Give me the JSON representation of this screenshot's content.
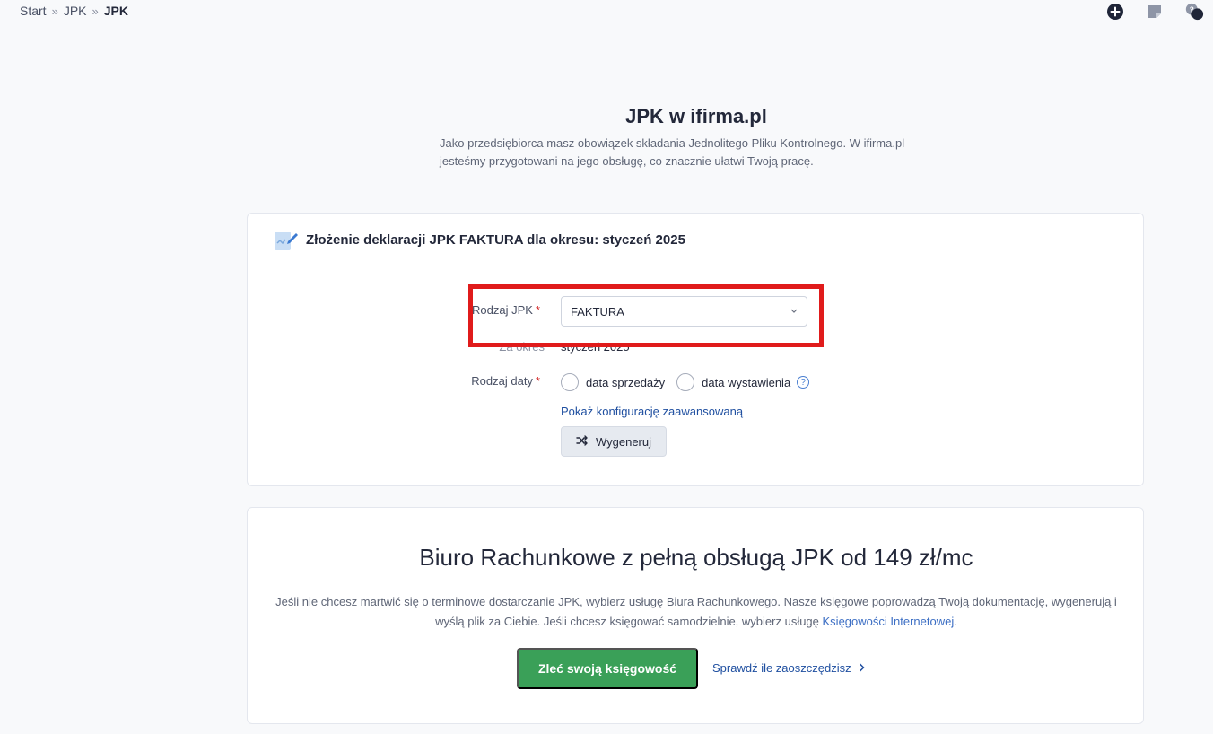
{
  "breadcrumb": {
    "items": [
      "Start",
      "JPK",
      "JPK"
    ],
    "separator": "»"
  },
  "hero": {
    "title": "JPK w ifirma.pl",
    "description_line1": "Jako przedsiębiorca masz obowiązek składania Jednolitego Pliku Kontrolnego. W ifirma.pl",
    "description_line2": "jesteśmy przygotowani na jego obsługę, co znacznie ułatwi Twoją pracę."
  },
  "declaration_card": {
    "title": "Złożenie deklaracji JPK FAKTURA dla okresu: styczeń 2025",
    "jpk_type_label": "Rodzaj JPK",
    "jpk_type_value": "FAKTURA",
    "period_label": "Za okres",
    "period_value": "styczeń 2025",
    "date_type_label": "Rodzaj daty",
    "required_mark": "*",
    "date_options": [
      "data sprzedaży",
      "data wystawienia"
    ],
    "help_mark": "?",
    "advanced_link": "Pokaż konfigurację zaawansowaną",
    "generate_button": "Wygeneruj"
  },
  "office_card": {
    "title": "Biuro Rachunkowe z pełną obsługą JPK od 149 zł/mc",
    "description_part1": "Jeśli nie chcesz martwić się o terminowe dostarczanie JPK, wybierz usługę Biura Rachunkowego. Nasze księgowe poprowadzą Twoją dokumentację, wygenerują i wyślą plik za Ciebie. Jeśli chcesz księgować samodzielnie, wybierz usługę ",
    "description_link": "Księgowości Internetowej",
    "description_part2": ".",
    "order_button": "Zleć swoją księgowość",
    "savings_link": "Sprawdź ile zaoszczędzisz"
  },
  "colors": {
    "accent_green": "#3aa058",
    "link_blue": "#1f4fa0",
    "highlight_red": "#e01b1b"
  }
}
